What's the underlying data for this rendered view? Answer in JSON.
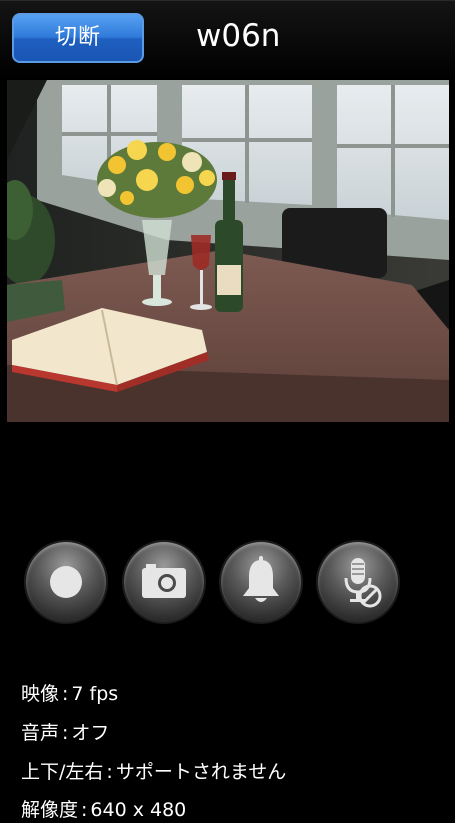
{
  "topbar": {
    "disconnect_label": "切断",
    "device_name": "w06n"
  },
  "controls": [
    {
      "icon": "record-icon"
    },
    {
      "icon": "camera-icon"
    },
    {
      "icon": "bell-icon"
    },
    {
      "icon": "mic-muted-icon"
    }
  ],
  "info": {
    "video_label": "映像",
    "video_value": "7 fps",
    "audio_label": "音声",
    "audio_value": "オフ",
    "pantilt_label": "上下/左右",
    "pantilt_value": "サポートされません",
    "resolution_label": "解像度",
    "resolution_value": "640 x 480"
  },
  "colors": {
    "accent": "#2f7ad9",
    "background": "#000000"
  }
}
